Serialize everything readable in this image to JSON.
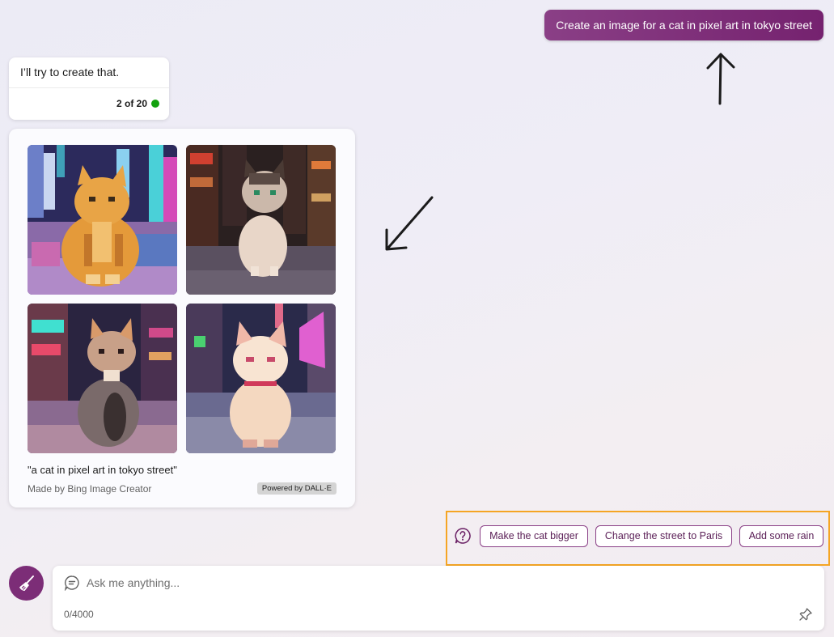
{
  "user_message": {
    "text": "Create an image for a cat in pixel art in tokyo street"
  },
  "reply": {
    "text": "I’ll try to create that.",
    "counter": "2 of 20",
    "status_color": "#13a10e"
  },
  "image_result": {
    "images": [
      {
        "icon": "pixel-art-cat-image"
      },
      {
        "icon": "pixel-art-cat-image"
      },
      {
        "icon": "pixel-art-cat-image"
      },
      {
        "icon": "pixel-art-cat-image"
      }
    ],
    "caption": "\"a cat in pixel art in tokyo street\"",
    "made_by": "Made by Bing Image Creator",
    "powered_by": "Powered by DALL·E"
  },
  "suggestions": {
    "icon": "question-circle-icon",
    "chips": [
      {
        "label": "Make the cat bigger"
      },
      {
        "label": "Change the street to Paris"
      },
      {
        "label": "Add some rain"
      }
    ],
    "highlight_color": "#f5a524"
  },
  "composer": {
    "new_topic_icon": "broom-icon",
    "chat_icon": "chat-bubble-icon",
    "placeholder": "Ask me anything...",
    "char_count": "0/4000",
    "pin_icon": "pin-icon"
  },
  "colors": {
    "accent": "#7c2d77",
    "user_bubble": "#8a3f86"
  }
}
